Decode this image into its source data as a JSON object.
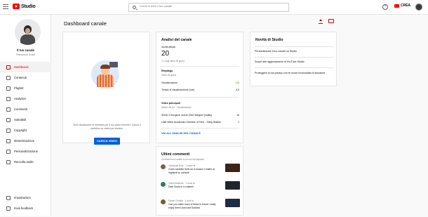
{
  "app": {
    "name": "Studio",
    "search_placeholder": "Cerca in tutto il tuo canale",
    "help": "?",
    "create_label": "CREA"
  },
  "channel": {
    "name": "Il tuo canale",
    "subtitle": "Francesco Rossi"
  },
  "sidebar": {
    "items": [
      {
        "label": "Dashboard",
        "icon": "dashboard-icon",
        "active": true
      },
      {
        "label": "Contenuti",
        "icon": "video-icon",
        "active": false
      },
      {
        "label": "Playlist",
        "icon": "playlist-icon",
        "active": false
      },
      {
        "label": "Analytics",
        "icon": "analytics-icon",
        "active": false
      },
      {
        "label": "Commenti",
        "icon": "comment-icon",
        "active": false
      },
      {
        "label": "Sottotitoli",
        "icon": "subtitles-icon",
        "active": false
      },
      {
        "label": "Copyright",
        "icon": "copyright-icon",
        "active": false
      },
      {
        "label": "Monetizzazione",
        "icon": "money-icon",
        "active": false
      },
      {
        "label": "Personalizzazione",
        "icon": "brush-icon",
        "active": false
      },
      {
        "label": "Raccolta audio",
        "icon": "audio-library-icon",
        "active": false
      }
    ],
    "bottom": [
      {
        "label": "Impostazioni",
        "icon": "gear-icon"
      },
      {
        "label": "Invia feedback",
        "icon": "feedback-icon"
      }
    ]
  },
  "page": {
    "title": "Dashboard canale"
  },
  "upload_card": {
    "text": "Vuoi visualizzare le metriche per il tuo video recente? Carica e pubblica un video per iniziare.",
    "button": "CARICA VIDEO"
  },
  "analytics": {
    "title": "Analisi del canale",
    "subs_label": "Iscritti attuali",
    "subs_value": "20",
    "subs_change": "+1 negli ultimi 28 giorni",
    "summary_title": "Riepilogo",
    "summary_period": "Ultimi 28 giorni",
    "views_label": "Visualizzazioni",
    "views_value": "128",
    "watch_label": "Tempo di visualizzazione (ore)",
    "watch_value": "0,6",
    "top_title": "Video principali",
    "top_period": "Ultime 48 ore · Visualizzazioni",
    "top_videos": [
      {
        "title": "Shrek 3 Dungeon scene (One Winged Quality)",
        "views": "16"
      },
      {
        "title": "Little Witch Academia Chamber of Time - Shiny Ballets",
        "views": "1"
      }
    ],
    "link": "VAI ALL'ANALISI DEL CANALE"
  },
  "news": {
    "title": "Novità di Studio",
    "items": [
      "Personalizzare il tuo canale su Studio",
      "Scopri altri aggiornamenti di YouTube Studio",
      "Proteggere la tua privacy con le nuove funzionalità di sfocatura"
    ]
  },
  "comments": {
    "title": "Ultimi commenti",
    "subtitle": "Commenti sul canale a cui non hai risposto",
    "items": [
      {
        "author": "Catriswan Bost · 1 mese fa",
        "text": "Come sarebbe bello se ci fossero il trailer di Ingrisciti su console",
        "avatar_color": "#8a5a44",
        "thumb_color": "#3b2416"
      },
      {
        "author": "VideoViralZone · 1 anno fa",
        "text": "Dark Souls in a nutshell",
        "avatar_color": "#2e7d5a",
        "thumb_color": "#20252e"
      },
      {
        "author": "Daniel Christie · 2 anni fa",
        "text": "Can you make more of these in future i really enjoy them Liked and Subbed",
        "avatar_color": "#7d5a2e",
        "thumb_color": "#202b44"
      }
    ]
  },
  "colors": {
    "accent": "#cc0000",
    "link": "#065fd4",
    "positive": "#2ba640"
  }
}
